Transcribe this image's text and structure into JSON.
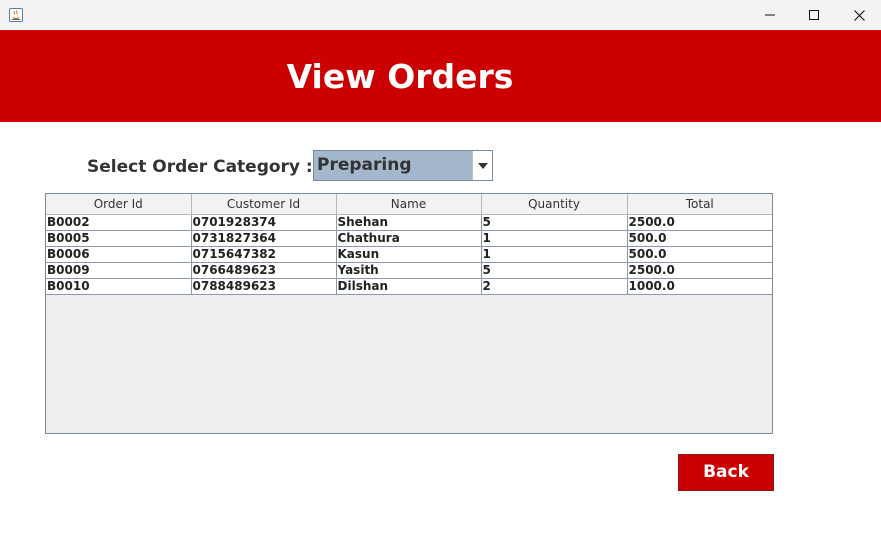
{
  "window": {
    "icon": "java-app-icon",
    "controls": [
      "minimize-icon",
      "maximize-icon",
      "close-icon"
    ]
  },
  "header": {
    "title": "View Orders",
    "background_color": "#cc0000"
  },
  "filter": {
    "label": "Select Order Category :",
    "selected": "Preparing"
  },
  "orders_table": {
    "columns": [
      "Order Id",
      "Customer Id",
      "Name",
      "Quantity",
      "Total"
    ],
    "rows": [
      [
        "B0002",
        "0701928374",
        "Shehan",
        "5",
        "2500.0"
      ],
      [
        "B0005",
        "0731827364",
        "Chathura",
        "1",
        "500.0"
      ],
      [
        "B0006",
        "0715647382",
        "Kasun",
        "1",
        "500.0"
      ],
      [
        "B0009",
        "0766489623",
        "Yasith",
        "5",
        "2500.0"
      ],
      [
        "B0010",
        "0788489623",
        "Dilshan",
        "2",
        "1000.0"
      ]
    ]
  },
  "actions": {
    "back_label": "Back"
  }
}
